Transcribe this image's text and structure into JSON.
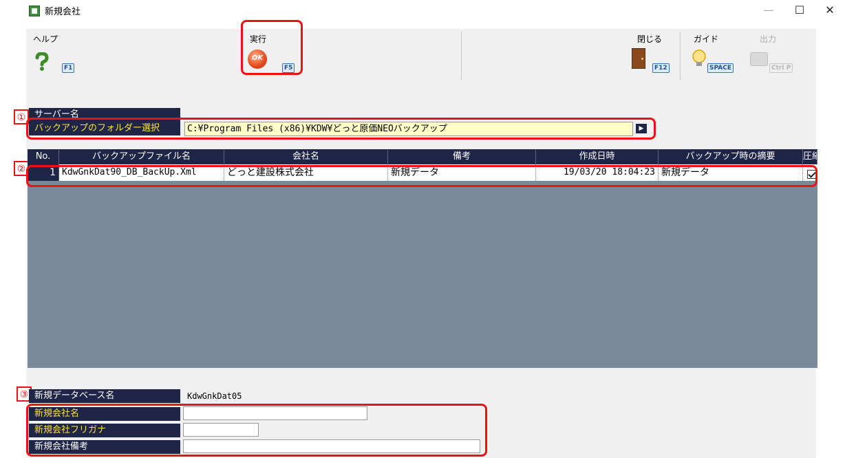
{
  "window": {
    "title": "新規会社",
    "minimize": "—",
    "maximize": "☐",
    "close": "✕"
  },
  "toolbar": {
    "help": {
      "label": "ヘルプ",
      "icon": "question-icon",
      "key": "F1"
    },
    "execute": {
      "label": "実行",
      "icon": "ok-icon",
      "key": "F5",
      "icon_text": "OK"
    },
    "close": {
      "label": "閉じる",
      "icon": "door-icon",
      "key": "F12"
    },
    "guide": {
      "label": "ガイド",
      "icon": "lightbulb-icon",
      "key": "SPACE"
    },
    "output": {
      "label": "出力",
      "icon": "printer-icon",
      "key": "Ctrl P"
    }
  },
  "markers": {
    "m1": "①",
    "m2": "②",
    "m3": "③"
  },
  "server": {
    "label": "サーバー名",
    "value": ""
  },
  "folder": {
    "label": "バックアップのフォルダー選択",
    "value": "C:¥Program Files (x86)¥KDW¥どっと原価NEOバックアップ",
    "browse": "▶"
  },
  "grid": {
    "columns": [
      "No.",
      "バックアップファイル名",
      "会社名",
      "備考",
      "作成日時",
      "バックアップ時の摘要",
      "圧縮"
    ],
    "rows": [
      {
        "no": "1",
        "file": "KdwGnkDat90_DB_BackUp.Xml",
        "company": "どっと建設株式会社",
        "note": "新規データ",
        "created": "19/03/20 18:04:23",
        "summary": "新規データ",
        "compressed": true
      }
    ]
  },
  "new_db": {
    "label": "新規データベース名",
    "value": "KdwGnkDat05"
  },
  "new_company": {
    "label": "新規会社名",
    "value": ""
  },
  "new_kana": {
    "label": "新規会社フリガナ",
    "value": ""
  },
  "new_note": {
    "label": "新規会社備考",
    "value": ""
  },
  "colors": {
    "header_bg": "#1f2546",
    "label_yellow": "#ffe23a",
    "grid_empty": "#7a8a9a",
    "highlight": "#ee1111",
    "folder_bg": "#ffffc8"
  }
}
